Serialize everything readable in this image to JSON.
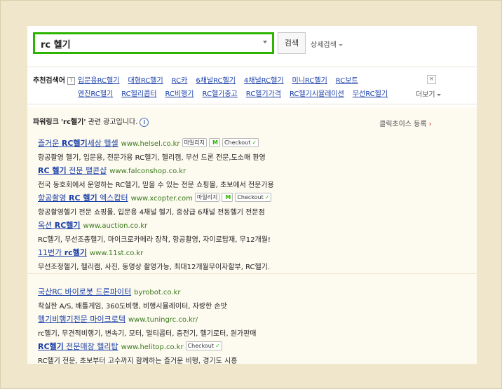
{
  "search": {
    "query": "rc 헬기",
    "button_label": "검색",
    "advanced_label": "상세검색"
  },
  "recommend": {
    "label": "추천검색어",
    "help": "?",
    "row1": [
      "입문용RC헬기",
      "대형RC헬기",
      "RC카",
      "6채널RC헬기",
      "4채널RC헬기",
      "미니RC헬기",
      "RC보트"
    ],
    "row2": [
      "엔진RC헬기",
      "RC헬리콥터",
      "RC비행기",
      "RC헬기중고",
      "RC헬기가격",
      "RC헬기시뮬레이션",
      "무선RC헬기"
    ],
    "close": "×",
    "more_label": "더보기"
  },
  "powerlink": {
    "title": "파워링크",
    "query_quoted": "'rc헬기'",
    "suffix": " 관련 광고입니다.",
    "info": "i",
    "register_label": "클릭초이스 등록",
    "register_arrow": "›"
  },
  "badges": {
    "mileage": "마일리지",
    "mileage_mark": "M",
    "checkout": "Checkout"
  },
  "ads": [
    {
      "title_pre": "즐거운 ",
      "title_bold": "RC헬기",
      "title_post": "세상 헬셀",
      "url": "www.helsel.co.kr",
      "desc": "항공촬영 헬기, 입문용, 전문가용 RC헬기, 헬리캠, 무선 드론 전문,도소매 환영"
    },
    {
      "title_pre": "",
      "title_bold": "RC 헬기",
      "title_post": " 전문 팰콘샵",
      "url": "www.falconshop.co.kr",
      "desc": "전국 동호회에서 운영하는 RC헬기, 믿을 수 있는 전문 쇼핑몰, 초보에서 전문가용"
    },
    {
      "title_pre": "항공촬영 ",
      "title_bold": "RC 헬기",
      "title_post": " 엑스캅터",
      "url": "www.xcopter.com",
      "desc": "항공촬영헬기 전문 쇼핑몰, 입문용 4채널 헬기, 중상급 6채널 전동헬기 전문점"
    },
    {
      "title_pre": "옥션 ",
      "title_bold": "RC헬기",
      "title_post": "",
      "url": "www.auction.co.kr",
      "desc": "RC헬기, 무선조종헬기, 마이크로카메라 장착, 항공촬영, 자이로탑재, 무12개월!"
    },
    {
      "title_pre": "11번가 ",
      "title_bold": "rc헬기",
      "title_post": "",
      "url": "www.11st.co.kr",
      "desc": "무선조정헬기, 헬리캠, 사진, 동영상 촬영가능, 최대12개월무이자할부, RC헬기."
    },
    {
      "title_pre": "국산RC 바이로봇 드론파이터",
      "title_bold": "",
      "title_post": "",
      "url": "byrobot.co.kr",
      "desc": "착실한 A/S, 배틀게임, 360도비행, 비행시뮬레이터, 자랑한 손맛"
    },
    {
      "title_pre": "헬기비행기전문 마이크로텍",
      "title_bold": "",
      "title_post": "",
      "url": "www.tuningrc.co.kr/",
      "desc": "rc헬기, 무견적비행기, 변속기, 모터, 멀티콥터, 충전기, 헬기로터, 원가판매"
    },
    {
      "title_pre": "",
      "title_bold": "RC헬기",
      "title_post": " 전문매장 헬리탑",
      "url": "www.helitop.co.kr",
      "desc": "RC헬기 전문, 초보부터 고수까지 함께하는 즐거운 비행, 경기도 시흥"
    }
  ]
}
